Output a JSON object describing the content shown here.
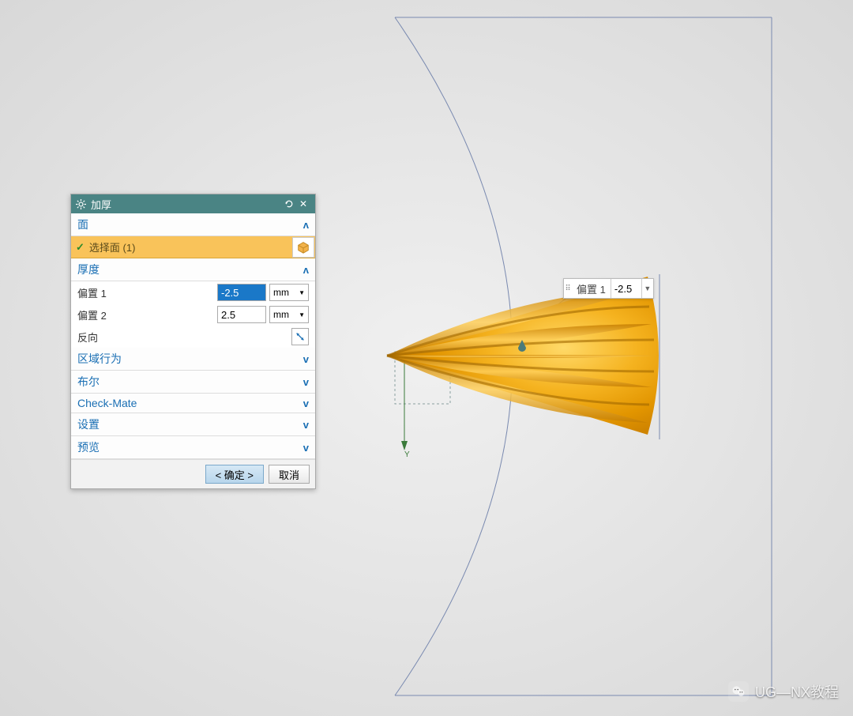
{
  "dialog": {
    "title": "加厚",
    "sections": {
      "face": {
        "title": "面",
        "select_face": "选择面 (1)",
        "expanded": true
      },
      "thickness": {
        "title": "厚度",
        "expanded": true,
        "offset1": {
          "label": "偏置 1",
          "value": "-2.5",
          "unit": "mm"
        },
        "offset2": {
          "label": "偏置 2",
          "value": "2.5",
          "unit": "mm"
        },
        "reverse_label": "反向"
      },
      "region": {
        "title": "区域行为"
      },
      "boolean": {
        "title": "布尔"
      },
      "checkmate": {
        "title": "Check-Mate"
      },
      "settings": {
        "title": "设置"
      },
      "preview": {
        "title": "预览"
      }
    },
    "buttons": {
      "ok": "< 确定 >",
      "cancel": "取消"
    }
  },
  "viewport": {
    "float_label": "偏置 1",
    "float_value": "-2.5",
    "axis_y": "Y"
  },
  "watermark": {
    "text": "UG—NX教程"
  }
}
